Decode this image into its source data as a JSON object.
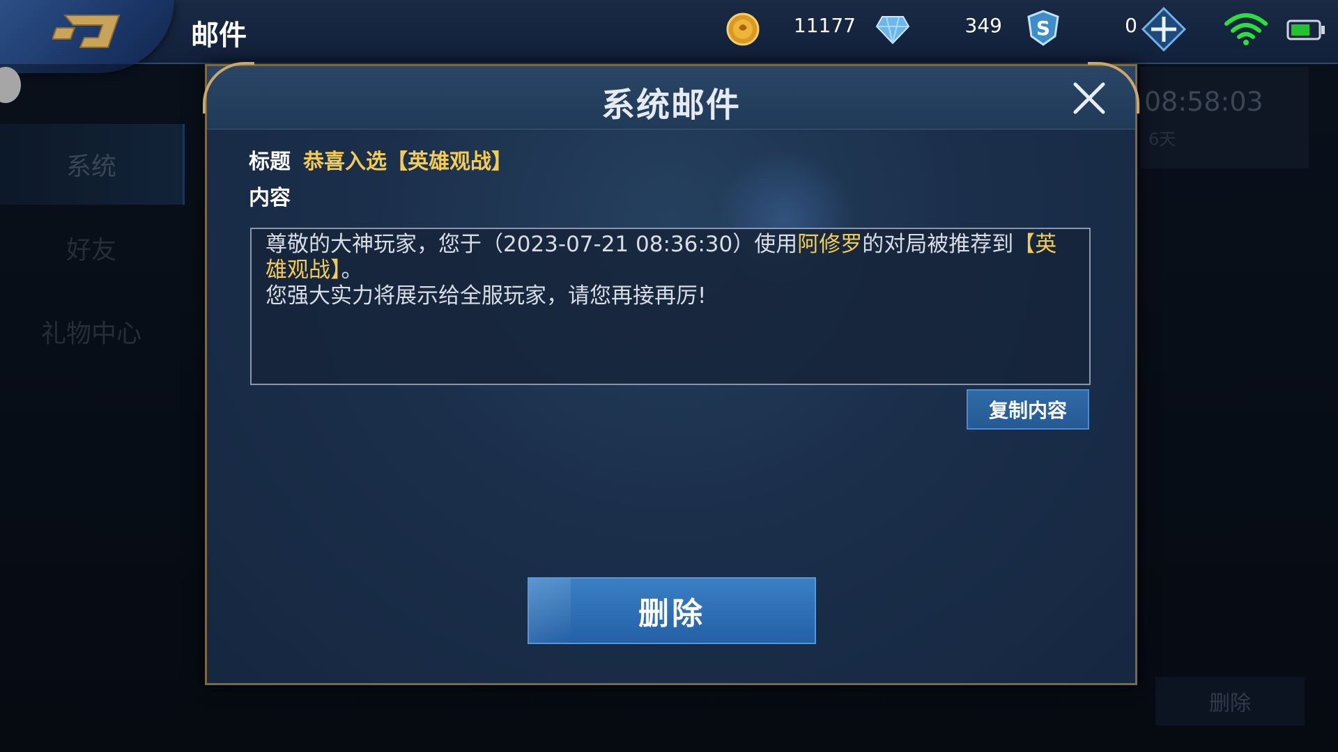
{
  "topbar": {
    "title": "邮件",
    "gold": "11177",
    "diamonds": "349",
    "vouchers": "0"
  },
  "sidebar": {
    "items": [
      {
        "label": "系统",
        "active": true
      },
      {
        "label": "好友",
        "active": false
      },
      {
        "label": "礼物中心",
        "active": false
      }
    ]
  },
  "background": {
    "time": "08:58:03",
    "days": "6天",
    "delete_label": "删除"
  },
  "modal": {
    "title": "系统邮件",
    "subject_label": "标题",
    "subject": "恭喜入选【英雄观战】",
    "content_label": "内容",
    "content": {
      "part1": "尊敬的大神玩家，您于（2023-07-21 08:36:30）使用",
      "hero": "阿修罗",
      "part2": "的对局被推荐到",
      "tag": "【英雄观战】",
      "part3": "。",
      "line2": "您强大实力将展示给全服玩家，请您再接再厉!"
    },
    "copy_label": "复制内容",
    "delete_label": "删除"
  },
  "colors": {
    "highlight": "#f2cc55",
    "button_blue": "#2460a6",
    "frame_gold": "#c9a868"
  },
  "icons": [
    "back-icon",
    "gold-coin-icon",
    "diamond-icon",
    "voucher-shield-icon",
    "plus-icon",
    "wifi-icon",
    "battery-icon",
    "close-icon"
  ]
}
